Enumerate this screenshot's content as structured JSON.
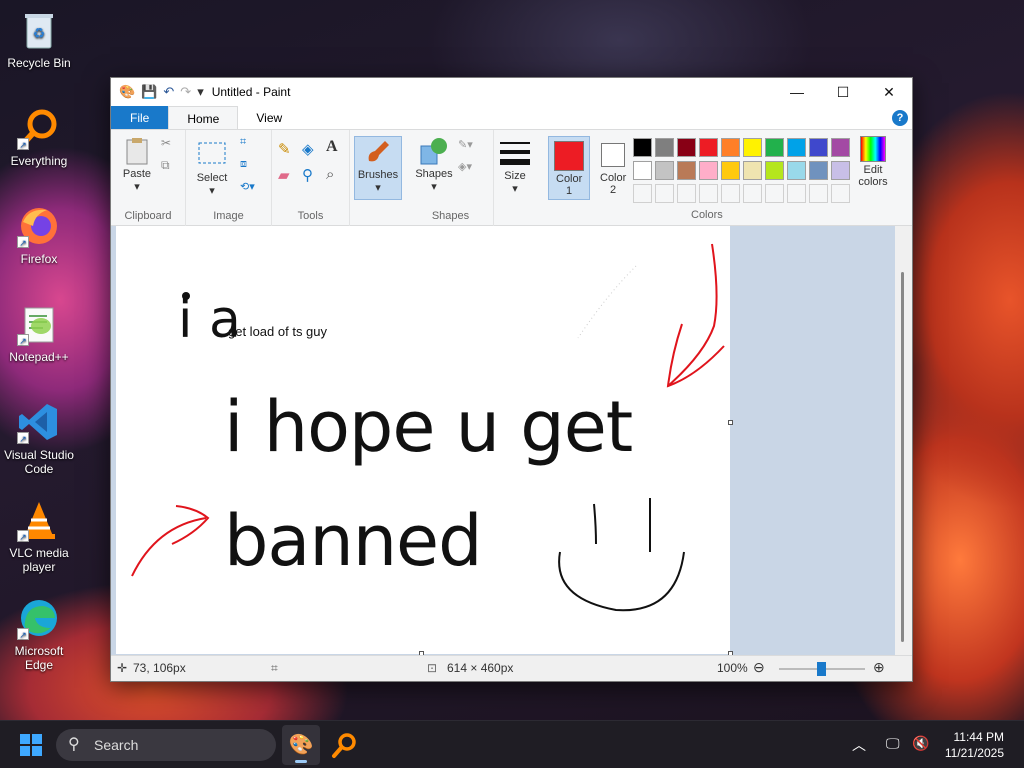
{
  "desktop": {
    "icons": [
      {
        "label": "Recycle Bin",
        "icon": "recycle-bin-icon"
      },
      {
        "label": "Everything",
        "icon": "everything-search-icon"
      },
      {
        "label": "Firefox",
        "icon": "firefox-icon"
      },
      {
        "label": "Notepad++",
        "icon": "notepadpp-icon"
      },
      {
        "label": "Visual Studio Code",
        "icon": "vscode-icon"
      },
      {
        "label": "VLC media player",
        "icon": "vlc-icon"
      },
      {
        "label": "Microsoft Edge",
        "icon": "edge-icon"
      }
    ]
  },
  "paint": {
    "title": "Untitled - Paint",
    "tabs": {
      "file": "File",
      "home": "Home",
      "view": "View"
    },
    "ribbon": {
      "clipboard": {
        "paste": "Paste",
        "label": "Clipboard"
      },
      "image": {
        "select": "Select",
        "label": "Image"
      },
      "tools": {
        "label": "Tools"
      },
      "brushes": "Brushes",
      "shapes": {
        "shapes": "Shapes",
        "label": "Shapes"
      },
      "size": "Size",
      "color1": "Color 1",
      "color2": "Color 2",
      "edit_colors": "Edit colors",
      "colors_label": "Colors",
      "color1_value": "#ed1c24",
      "color2_value": "#ffffff",
      "palette_row1": [
        "#000000",
        "#7f7f7f",
        "#880015",
        "#ed1c24",
        "#ff7f27",
        "#fff200",
        "#22b14c",
        "#00a2e8",
        "#3f48cc",
        "#a349a4"
      ],
      "palette_row2": [
        "#ffffff",
        "#c3c3c3",
        "#b97a57",
        "#ffaec9",
        "#ffc90e",
        "#efe4b0",
        "#b5e61d",
        "#99d9ea",
        "#7092be",
        "#c8bfe7"
      ]
    },
    "canvas_text": {
      "partial": "i a",
      "small": "get load of ts guy",
      "line1": "i hope u get",
      "line2": "banned"
    },
    "status": {
      "cursor_pos": "73, 106px",
      "canvas_size": "614 × 460px",
      "zoom": "100%"
    }
  },
  "taskbar": {
    "search_placeholder": "Search",
    "time": "11:44 PM",
    "date": "11/21/2025"
  }
}
